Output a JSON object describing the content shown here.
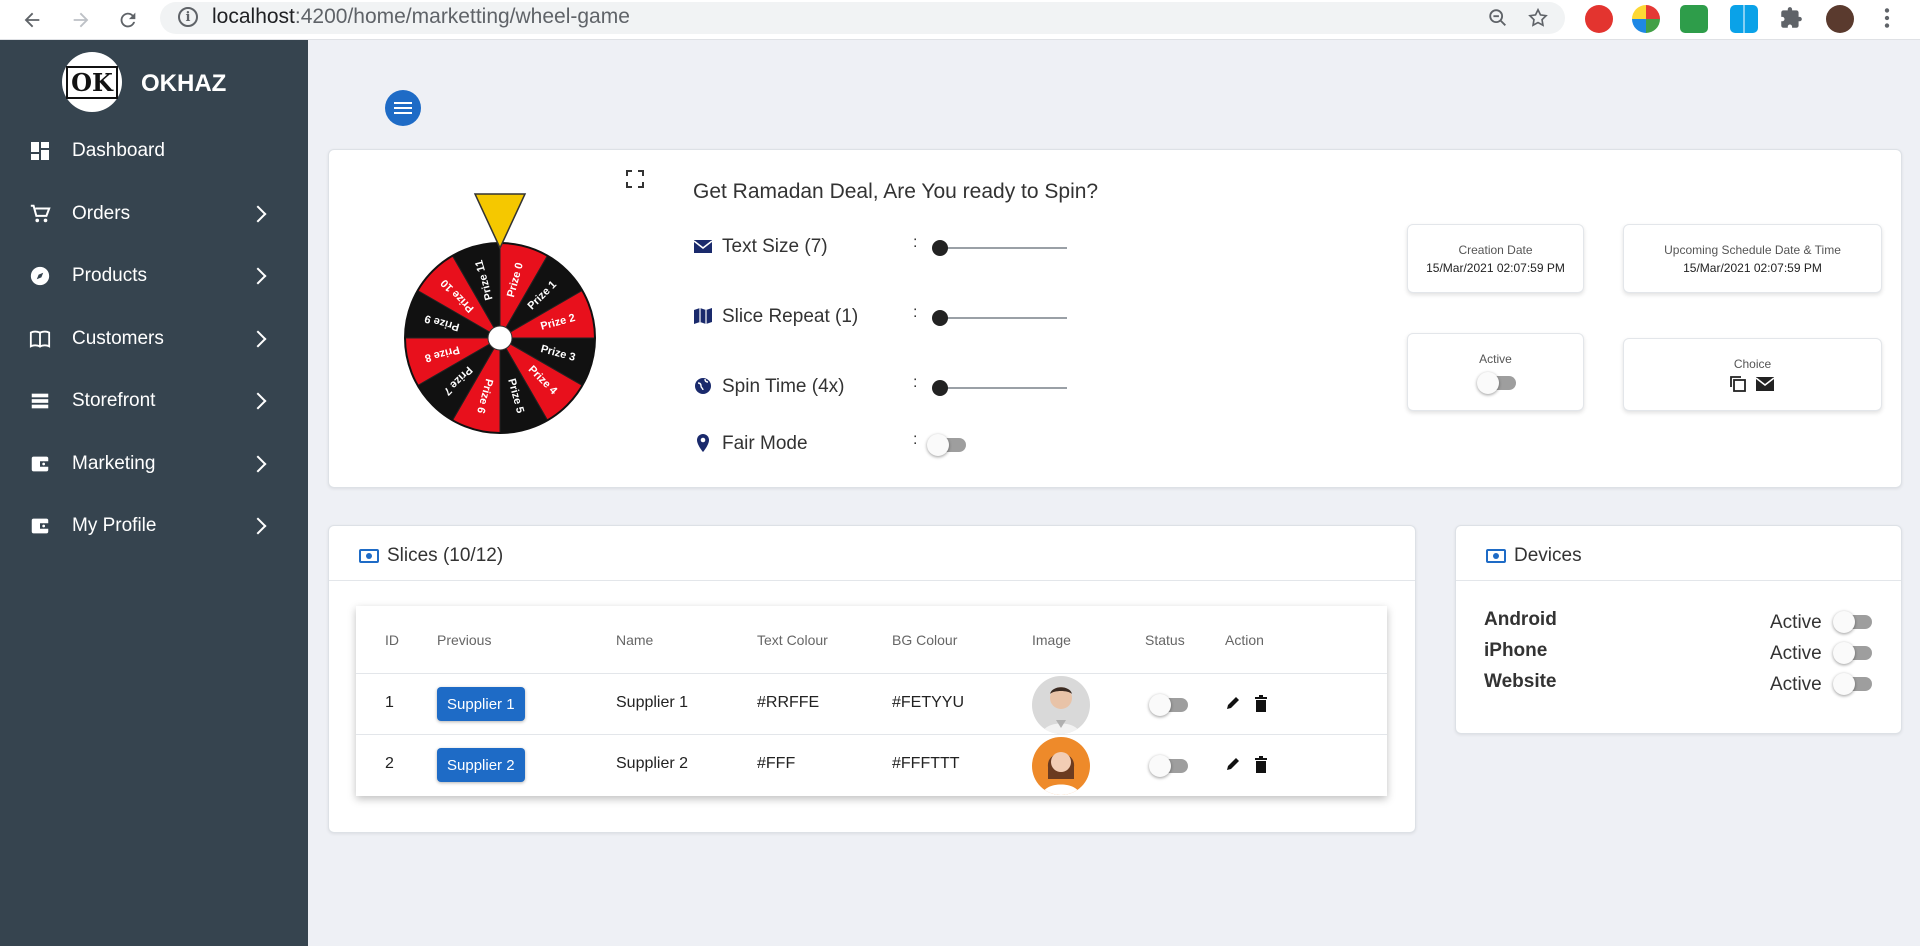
{
  "browser": {
    "url_host": "localhost",
    "url_path": ":4200/home/marketting/wheel-game"
  },
  "brand": {
    "name": "OKHAZ",
    "logo_text": "OK"
  },
  "sidebar": {
    "items": [
      {
        "label": "Dashboard",
        "icon": "dashboard-icon",
        "has_children": false
      },
      {
        "label": "Orders",
        "icon": "cart-icon",
        "has_children": true
      },
      {
        "label": "Products",
        "icon": "compass-icon",
        "has_children": true
      },
      {
        "label": "Customers",
        "icon": "book-icon",
        "has_children": true
      },
      {
        "label": "Storefront",
        "icon": "list-icon",
        "has_children": true
      },
      {
        "label": "Marketing",
        "icon": "wallet-icon",
        "has_children": true
      },
      {
        "label": "My Profile",
        "icon": "wallet-icon",
        "has_children": true
      }
    ]
  },
  "wheel": {
    "prizes": [
      "Prize 0",
      "Prize 1",
      "Prize 2",
      "Prize 3",
      "Prize 4",
      "Prize 5",
      "Prize 6",
      "Prize 7",
      "Prize 8",
      "Prize 9",
      "Prize 10",
      "Prize 11"
    ],
    "colors": [
      "#e8101c",
      "#111111"
    ],
    "pointer_color": "#f5c800"
  },
  "deal": {
    "title": "Get Ramadan Deal, Are You ready to Spin?",
    "controls": [
      {
        "label": "Text Size (7)",
        "icon": "envelope-icon",
        "colon": ":",
        "type": "slider",
        "value": 0
      },
      {
        "label": "Slice Repeat (1)",
        "icon": "map-icon",
        "colon": ":",
        "type": "slider",
        "value": 0
      },
      {
        "label": "Spin Time (4x)",
        "icon": "globe-icon",
        "colon": ":",
        "type": "slider",
        "value": 0
      },
      {
        "label": "Fair Mode",
        "icon": "pin-icon",
        "colon": ":",
        "type": "toggle",
        "on": false
      }
    ]
  },
  "info": {
    "creation_label": "Creation Date",
    "creation_value": "15/Mar/2021 02:07:59 PM",
    "schedule_label": "Upcoming Schedule Date & Time",
    "schedule_value": "15/Mar/2021 02:07:59 PM",
    "active_label": "Active",
    "choice_label": "Choice"
  },
  "slices": {
    "title": "Slices (10/12)",
    "headers": [
      "ID",
      "Previous",
      "Name",
      "Text Colour",
      "BG Colour",
      "Image",
      "Status",
      "Action"
    ],
    "rows": [
      {
        "id": "1",
        "previous": "Supplier 1",
        "name": "Supplier 1",
        "text_colour": "#RRFFE",
        "bg_colour": "#FETYYU",
        "image": "man-avatar",
        "status": false
      },
      {
        "id": "2",
        "previous": "Supplier 2",
        "name": "Supplier 2",
        "text_colour": "#FFF",
        "bg_colour": "#FFFTTT",
        "image": "woman-avatar",
        "status": false
      }
    ]
  },
  "devices": {
    "title": "Devices",
    "items": [
      {
        "name": "Android",
        "status": "Active",
        "on": false
      },
      {
        "name": "iPhone",
        "status": "Active",
        "on": false
      },
      {
        "name": "Website",
        "status": "Active",
        "on": false
      }
    ]
  },
  "colors": {
    "sidebar": "#36444f",
    "accent": "#1e6bc6",
    "background": "#eef0f5"
  }
}
